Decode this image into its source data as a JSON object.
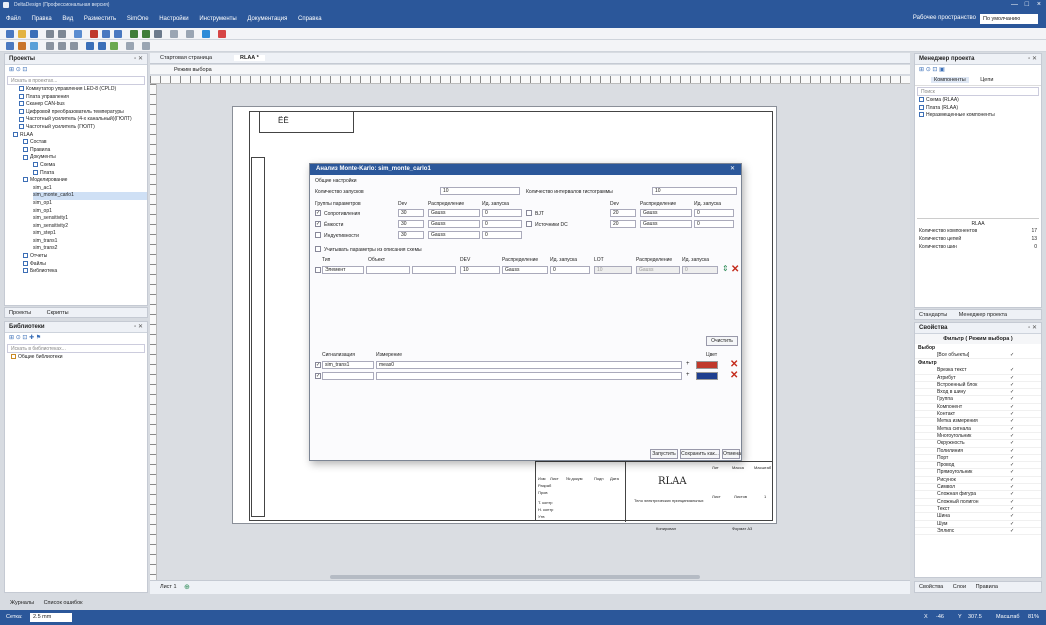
{
  "window": {
    "title": "DeltaDesign (Профессиональная версия)",
    "min": "—",
    "max": "□",
    "close": "×"
  },
  "menu": [
    "Файл",
    "Правка",
    "Вид",
    "Разместить",
    "SimOne",
    "Настройки",
    "Инструменты",
    "Документация",
    "Справка"
  ],
  "workspace": {
    "label": "Рабочее пространство",
    "value": "По умолчанию"
  },
  "projects": {
    "title": "Проекты",
    "search_placeholder": "Искать в проектах...",
    "items": [
      "Коммутатор управления LED-8 (CPLD)",
      "Плата управления",
      "Сканер CAN-bus",
      "Цифровой преобразователь температуры",
      "Частотный усилитель (4-х канальный)(ГЮЛТ)",
      "Частотный усилитель (ГЮЛТ)",
      "RLAA",
      "Состав",
      "Правила",
      "Документы",
      "Схема",
      "Плата",
      "Моделирование",
      "sim_ac1",
      "sim_monte_carlo1",
      "sim_op1",
      "sim_op1",
      "sim_sensitivity1",
      "sim_sensitivity2",
      "sim_step1",
      "sim_trans1",
      "sim_trans2",
      "Отчеты",
      "Файлы",
      "Библиотека"
    ],
    "tab_projects": "Проекты",
    "tab_scripts": "Скрипты"
  },
  "libraries": {
    "title": "Библиотеки",
    "search_placeholder": "Искать в библиотеках...",
    "item": "Общие библиотеки"
  },
  "document_tabs": {
    "start": "Стартовая страница",
    "rlaa": "RLAA *",
    "mode": "Режим выбора"
  },
  "sheet": {
    "tab": "Лист 1",
    "logo": "ЁЁ",
    "title_block_name": "RLAA",
    "note": "Тело электрических принципиальных",
    "sheet_label": "Копировал",
    "format_label": "Формат A3",
    "lit": "Лит",
    "mass": "Масса",
    "scale": "Масштаб",
    "list": "Лист",
    "lists": "Листов",
    "change": "Изм",
    "list2": "Лист",
    "doc": "№ докум",
    "sign": "Подп",
    "date": "Дата",
    "dev": "Разраб",
    "check": "Пров",
    "tcontr": "Т. контр",
    "ncontr": "Н. контр",
    "approved": "Утв",
    "one": "1"
  },
  "dialog": {
    "title": "Анализ Monte-Karlo: sim_monte_carlo1",
    "general": "Общие настройки",
    "runs_label": "Количество запусков",
    "runs_value": "10",
    "hist_label": "Количество интервалов гистограммы",
    "hist_value": "10",
    "groups_label": "Группы параметров",
    "dev": "Dev",
    "distribution": "Распределение",
    "runid": "Ид. запуска",
    "rows_left": [
      {
        "checked": "✓",
        "name": "Сопротивления",
        "dev": "30",
        "dist": "Gauss",
        "id": "0"
      },
      {
        "checked": "✓",
        "name": "Ёмкости",
        "dev": "30",
        "dist": "Gauss",
        "id": "0"
      },
      {
        "checked": "",
        "name": "Индуктивности",
        "dev": "30",
        "dist": "Gauss",
        "id": "0"
      }
    ],
    "rows_right": [
      {
        "checked": "",
        "name": "BJT",
        "dev": "20",
        "dist": "Gauss",
        "id": "0"
      },
      {
        "checked": "",
        "name": "Источники DC",
        "dev": "20",
        "dist": "Gauss",
        "id": "0"
      }
    ],
    "consider": "Учитывать параметры из описания схемы",
    "type": "Тип",
    "object": "Объект",
    "dev_col": "DEV",
    "lot": "LOT",
    "elem_row": {
      "type": "Элемент",
      "dev": "10",
      "dist": "Gauss",
      "id": "0",
      "lot": "10",
      "dist2": "Gauss",
      "id2": "0"
    },
    "clear": "Очистить",
    "signal": "Сигнализация",
    "measure": "Измерение",
    "color": "Цвет",
    "sig_rows": [
      {
        "checked": "✓",
        "signal": "sim_trans1",
        "measure": "meas0",
        "color": "#c0392b"
      },
      {
        "checked": "✓",
        "signal": "",
        "measure": "",
        "color": "#1f3f8f"
      }
    ],
    "run": "Запустить",
    "save": "Сохранить как...",
    "cancel": "Отмена"
  },
  "project_manager": {
    "title": "Менеджер проекта",
    "tab_components": "Компоненты",
    "tab_nets": "Цепи",
    "search_placeholder": "Поиск",
    "items": [
      "Схема (RLAA)",
      "Плата (RLAA)",
      "Неразмещенные компоненты"
    ],
    "summary_title": "RLAA",
    "stats": [
      {
        "label": "Количество компонентов",
        "value": "17"
      },
      {
        "label": "Количество цепей",
        "value": "13"
      },
      {
        "label": "Количество шин",
        "value": "0"
      }
    ],
    "tab_standards": "Стандарты",
    "tab_pm": "Менеджер проекта"
  },
  "properties": {
    "title": "Свойства",
    "filter_header": "Фильтр ( Режим выбора )",
    "selection": "Выбор",
    "all_objects": "[Все объекты]",
    "filter": "Фильтр",
    "filters": [
      "Врезка текст",
      "Атрибут",
      "Встроенный блок",
      "Вход в шину",
      "Группа",
      "Компонент",
      "Контакт",
      "Метка измерения",
      "Метка сигнала",
      "Многоугольник",
      "Окружность",
      "Полилиния",
      "Порт",
      "Провод",
      "Прямоугольник",
      "Рисунок",
      "Символ",
      "Сложная фигура",
      "Сложный полигон",
      "Текст",
      "Шина",
      "Шум",
      "Эллипс"
    ],
    "tab_props": "Свойства",
    "tab_layers": "Слои",
    "tab_rules": "Правила"
  },
  "bottom": {
    "journals": "Журналы",
    "errors": "Список ошибок"
  },
  "status": {
    "grid_label": "Сетка:",
    "grid_value": "2.5 mm",
    "x_label": "X",
    "x": "-46",
    "y_label": "Y",
    "y": "307.5",
    "scale_label": "Масштаб",
    "scale": "81%"
  }
}
